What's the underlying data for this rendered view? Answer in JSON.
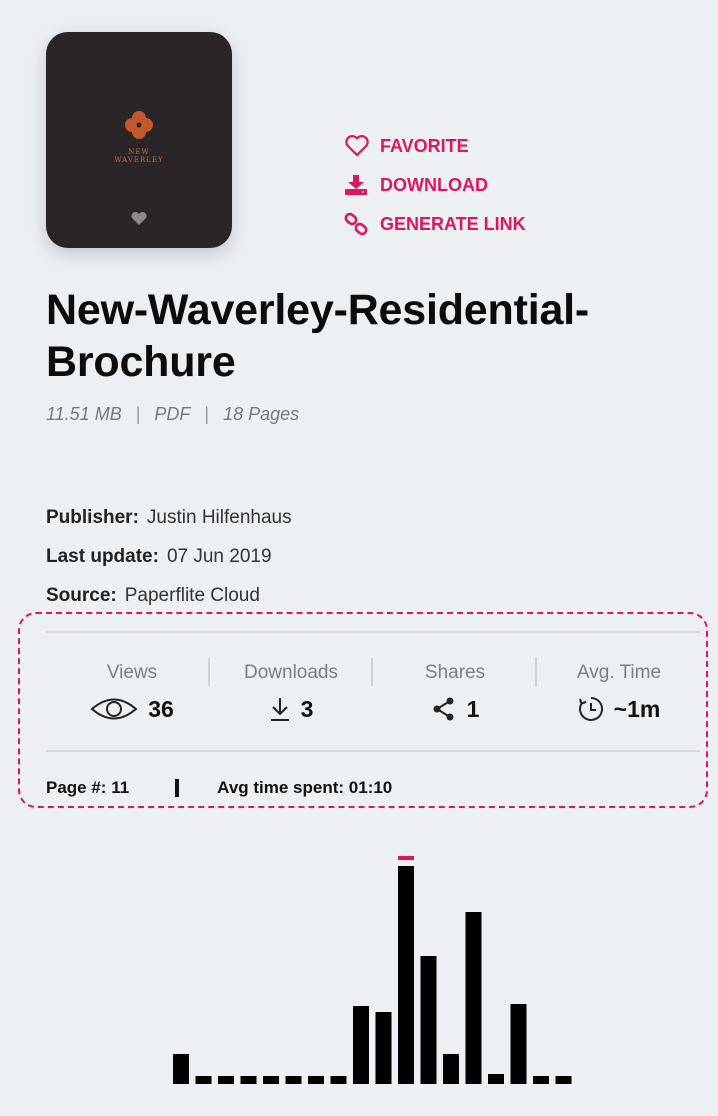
{
  "document": {
    "title": "New-Waverley-Residential-Brochure",
    "title_line1": "New-Waverley-Residential-",
    "title_line2": "Brochure",
    "size": "11.51 MB",
    "type": "PDF",
    "pages": "18 Pages",
    "thumbnail": {
      "brand": "NEW\nWAVERLEY"
    }
  },
  "actions": {
    "favorite": "FAVORITE",
    "download": "DOWNLOAD",
    "generate_link": "GENERATE LINK"
  },
  "info": {
    "publisher_label": "Publisher:",
    "publisher_value": "Justin Hilfenhaus",
    "update_label": "Last update:",
    "update_value": "07 Jun 2019",
    "source_label": "Source:",
    "source_value": "Paperflite Cloud"
  },
  "stats": {
    "views_label": "Views",
    "views_value": "36",
    "downloads_label": "Downloads",
    "downloads_value": "3",
    "shares_label": "Shares",
    "shares_value": "1",
    "avg_time_label": "Avg. Time",
    "avg_time_value": "~1m",
    "page_label": "Page #: 11",
    "avg_spent_label": "Avg time spent: 01:10"
  },
  "colors": {
    "accent": "#e0155f",
    "bar": "#000000",
    "background": "#edf0f3"
  },
  "chart_data": {
    "type": "bar",
    "categories": [
      "1",
      "2",
      "3",
      "4",
      "5",
      "6",
      "7",
      "8",
      "9",
      "10",
      "11",
      "12",
      "13",
      "14",
      "15",
      "16",
      "17",
      "18"
    ],
    "values": [
      30,
      8,
      8,
      8,
      8,
      8,
      8,
      8,
      78,
      72,
      218,
      128,
      30,
      172,
      10,
      80,
      8,
      8
    ],
    "highlighted_category": "11",
    "title": "",
    "xlabel": "",
    "ylabel": ""
  }
}
